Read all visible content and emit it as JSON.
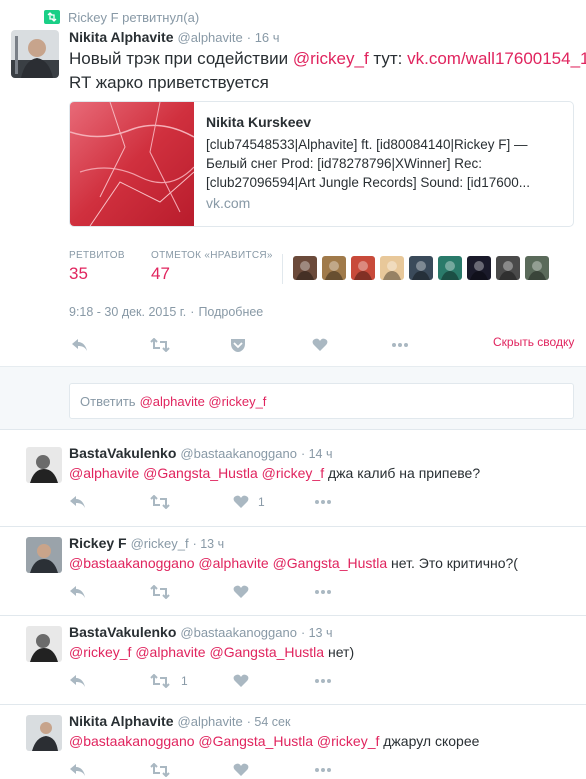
{
  "retweet_context": {
    "icon": "retweet-icon",
    "text": "Rickey F ретвитнул(а)"
  },
  "main_tweet": {
    "author_name": "Nikita Alphavite",
    "author_handle": "@alphavite",
    "time": "· 16 ч",
    "text_part1": "Новый трэк при содействии ",
    "mention": "@rickey_f",
    "text_part2": " тут: ",
    "link": "vk.com/wall17600154_1...",
    "text_line2": "RT жарко приветствуется",
    "card": {
      "title": "Nikita Kurskeev",
      "desc": "[club74548533|Alphavite] ft. [id80084140|Rickey F] — Белый снег Prod: [id78278796|XWinner] Rec: [club27096594|Art Jungle Records] Sound: [id17600...",
      "domain": "vk.com"
    },
    "stats": {
      "retweets_label": "РЕТВИТОВ",
      "retweets_value": "35",
      "likes_label": "ОТМЕТОК «НРАВИТСЯ»",
      "likes_value": "47"
    },
    "liker_avatars": [
      "#6b4a3a",
      "#a07a4a",
      "#c84a3a",
      "#e8c89a",
      "#3a4a5a",
      "#2a7a6a",
      "#1a1a2a",
      "#4a4a4a",
      "#5a6a5a"
    ],
    "timestamp": "9:18 - 30 дек. 2015 г.",
    "details_link": "Подробнее",
    "hide_summary": "Скрыть сводку"
  },
  "reply_box": {
    "prefix": "Ответить ",
    "mentions": "@alphavite @rickey_f"
  },
  "replies": [
    {
      "name": "BastaVakulenko",
      "handle": "@bastaakanoggano",
      "time": "· 14 ч",
      "mentions": "@alphavite @Gangsta_Hustla @rickey_f",
      "text": " джа калиб на припеве?",
      "retweets": "",
      "likes": "1"
    },
    {
      "name": "Rickey F",
      "handle": "@rickey_f",
      "time": "· 13 ч",
      "mentions": "@bastaakanoggano @alphavite @Gangsta_Hustla",
      "text": " нет. Это критично?(",
      "retweets": "",
      "likes": ""
    },
    {
      "name": "BastaVakulenko",
      "handle": "@bastaakanoggano",
      "time": "· 13 ч",
      "mentions": "@rickey_f @alphavite @Gangsta_Hustla",
      "text": " нет)",
      "retweets": "1",
      "likes": ""
    },
    {
      "name": "Nikita Alphavite",
      "handle": "@alphavite",
      "time": "· 54 сек",
      "mentions": "@bastaakanoggano @Gangsta_Hustla @rickey_f",
      "text": " джарул скорее",
      "retweets": "",
      "likes": ""
    }
  ]
}
